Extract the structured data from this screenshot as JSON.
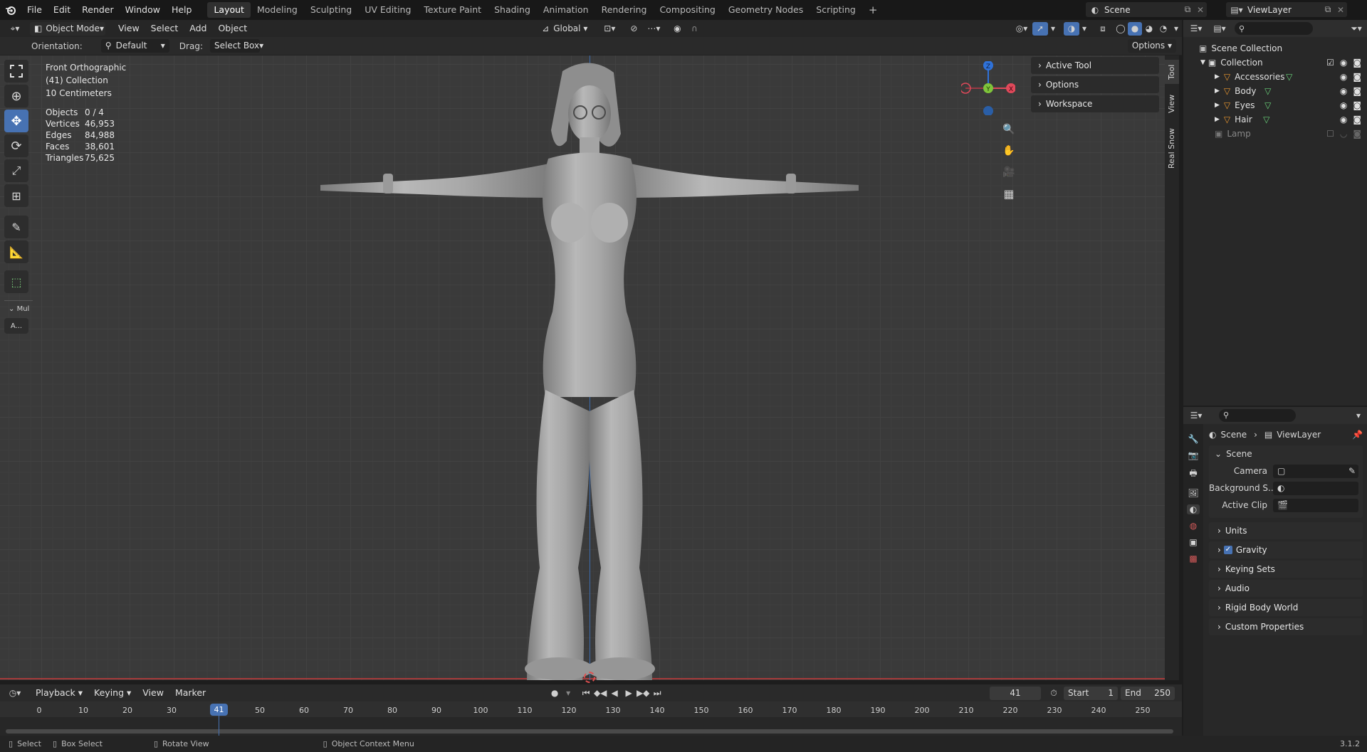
{
  "app": {
    "accent": "#4772b3"
  },
  "topbar": {
    "menus": [
      "File",
      "Edit",
      "Render",
      "Window",
      "Help"
    ],
    "workspaces": [
      "Layout",
      "Modeling",
      "Sculpting",
      "UV Editing",
      "Texture Paint",
      "Shading",
      "Animation",
      "Rendering",
      "Compositing",
      "Geometry Nodes",
      "Scripting"
    ],
    "active_workspace": "Layout",
    "add_label": "+",
    "scene_name": "Scene",
    "view_layer": "ViewLayer"
  },
  "header": {
    "mode": "Object Mode",
    "menus": [
      "View",
      "Select",
      "Add",
      "Object"
    ],
    "transform_orientation": "Global"
  },
  "toolsettings": {
    "orientation_label": "Orientation:",
    "orientation_value": "Default",
    "drag_label": "Drag:",
    "drag_value": "Select Box",
    "options_label": "Options"
  },
  "overlay": {
    "view_name": "Front Orthographic",
    "collection": "(41) Collection",
    "scale": "10 Centimeters",
    "stats": [
      {
        "label": "Objects",
        "value": "0 / 4"
      },
      {
        "label": "Vertices",
        "value": "46,953"
      },
      {
        "label": "Edges",
        "value": "84,988"
      },
      {
        "label": "Faces",
        "value": "38,601"
      },
      {
        "label": "Triangles",
        "value": "75,625"
      }
    ]
  },
  "toolbar": {
    "tools": [
      "select-box",
      "cursor",
      "move",
      "rotate",
      "scale",
      "transform",
      "annotate",
      "measure",
      "add-cube"
    ],
    "active_tool": "move",
    "panel_label": "Mul",
    "panel_button": "A..."
  },
  "gizmo": {
    "z": "Z",
    "y": "Y",
    "x": "X"
  },
  "npanel": {
    "sections": [
      "Active Tool",
      "Options",
      "Workspace"
    ],
    "tabs": [
      "Tool",
      "View",
      "Real Snow"
    ]
  },
  "outliner": {
    "search_placeholder": "",
    "root": "Scene Collection",
    "collection": "Collection",
    "items": [
      "Accessories",
      "Body",
      "Eyes",
      "Hair"
    ],
    "lamp": "Lamp"
  },
  "properties": {
    "breadcrumb_scene": "Scene",
    "breadcrumb_layer": "ViewLayer",
    "scene_header": "Scene",
    "camera_label": "Camera",
    "background_label": "Background S...",
    "clip_label": "Active Clip",
    "sections": [
      "Units",
      "Gravity",
      "Keying Sets",
      "Audio",
      "Rigid Body World",
      "Custom Properties"
    ]
  },
  "timeline": {
    "menus": [
      "Playback",
      "Keying",
      "View",
      "Marker"
    ],
    "current_frame": "41",
    "start_label": "Start",
    "start": "1",
    "end_label": "End",
    "end": "250",
    "ticks": [
      "0",
      "10",
      "20",
      "30",
      "41",
      "50",
      "60",
      "70",
      "80",
      "90",
      "100",
      "110",
      "120",
      "130",
      "140",
      "150",
      "160",
      "170",
      "180",
      "190",
      "200",
      "210",
      "220",
      "230",
      "240",
      "250"
    ]
  },
  "statusbar": {
    "items": [
      "Select",
      "Box Select",
      "Rotate View",
      "Object Context Menu"
    ],
    "version": "3.1.2"
  }
}
